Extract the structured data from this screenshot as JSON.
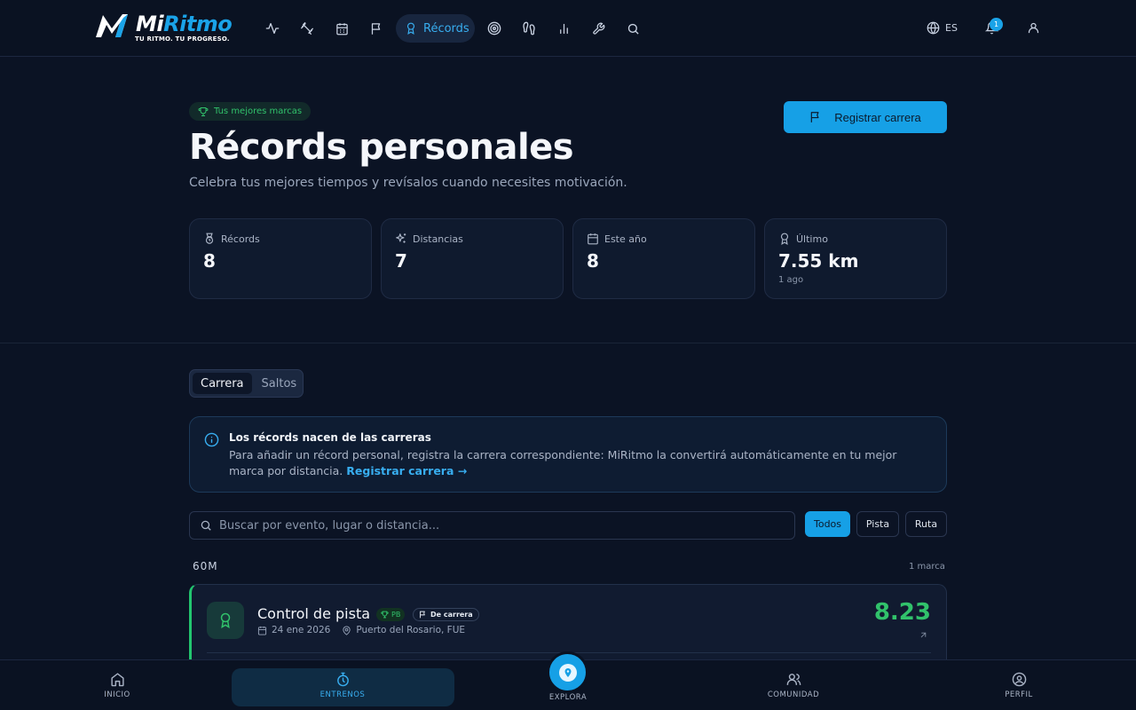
{
  "brand": {
    "name_a": "Mi",
    "name_b": "Ritmo",
    "tagline": "TU RITMO. TU PROGRESO.",
    "accent": "#1aa3e8"
  },
  "nav": {
    "icons": [
      "activity-icon",
      "dumbbell-icon",
      "calendar-icon",
      "flag-icon",
      "target-icon",
      "footprints-icon",
      "bar-chart-icon",
      "wrench-icon",
      "search-icon"
    ],
    "active_label": "Récords",
    "lang": "ES",
    "notifications": "1"
  },
  "hero": {
    "chip": "Tus mejores marcas",
    "title": "Récords personales",
    "subtitle": "Celebra tus mejores tiempos y revísalos cuando necesites motivación.",
    "primary_button": "Registrar carrera"
  },
  "stats": [
    {
      "label": "Récords",
      "value": "8",
      "sub": ""
    },
    {
      "label": "Distancias",
      "value": "7",
      "sub": ""
    },
    {
      "label": "Este año",
      "value": "8",
      "sub": ""
    },
    {
      "label": "Último",
      "value": "7.55 km",
      "sub": "1 ago"
    }
  ],
  "segment": {
    "options": [
      "Carrera",
      "Saltos"
    ],
    "selected": "Carrera"
  },
  "info": {
    "title": "Los récords nacen de las carreras",
    "body": "Para añadir un récord personal, registra la carrera correspondiente: MiRitmo la convertirá automáticamente en tu mejor marca por distancia.",
    "link": "Registrar carrera →"
  },
  "search": {
    "placeholder": "Buscar por evento, lugar o distancia...",
    "value": ""
  },
  "filters": {
    "all": "Todos",
    "track": "Pista",
    "road": "Ruta",
    "selected": "Todos"
  },
  "group": {
    "label": "60M",
    "count": "1 marca",
    "records": [
      {
        "title": "Control de pista",
        "pb": "PB",
        "source": "De carrera",
        "date": "24 ene 2026",
        "place": "Puerto del Rosario, FUE",
        "value": "8.23",
        "color": "#22c56f"
      }
    ]
  },
  "bottom_nav": {
    "home": "INICIO",
    "training": "ENTRENOS",
    "explore": "EXPLORA",
    "community": "COMUNIDAD",
    "profile": "PERFIL",
    "active": "ENTRENOS"
  }
}
